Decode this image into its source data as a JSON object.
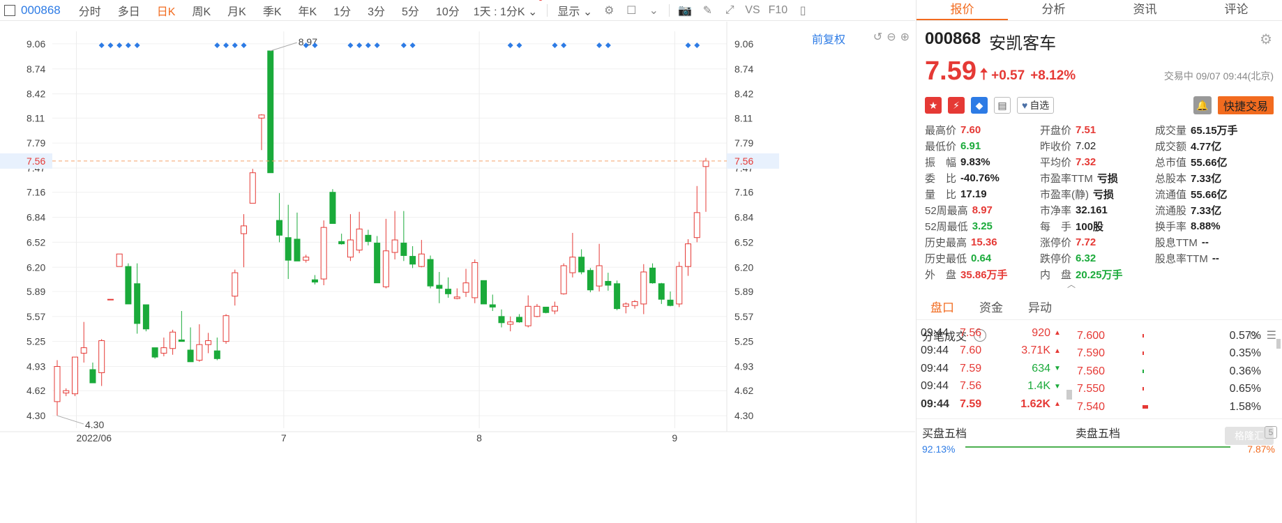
{
  "toolbar": {
    "code": "000868",
    "periods": [
      "分时",
      "多日",
      "日K",
      "周K",
      "月K",
      "季K",
      "年K",
      "1分",
      "3分",
      "5分",
      "10分"
    ],
    "active_period": "日K",
    "range_select": "1天 : 1分K",
    "display_select": "显示",
    "vs_label": "VS",
    "f10_label": "F10"
  },
  "chart": {
    "adjust_label": "前复权",
    "current_price_label": "7.56",
    "high_marker": "8.97",
    "low_marker": "4.30",
    "colors": {
      "up": "#e53935",
      "down": "#1aaa3a",
      "current_line": "#f3a06a",
      "signal": "#2d7be5"
    }
  },
  "chart_data": {
    "type": "candlestick",
    "y_ticks": [
      "9.06",
      "8.74",
      "8.42",
      "8.11",
      "7.79",
      "7.47",
      "7.16",
      "6.84",
      "6.52",
      "6.20",
      "5.89",
      "5.57",
      "5.25",
      "4.93",
      "4.62",
      "4.30"
    ],
    "x_labels": [
      "2022/06",
      "7",
      "8",
      "9"
    ],
    "ylim": [
      4.14,
      9.22
    ],
    "grid": true,
    "current_price": 7.56,
    "candles": [
      {
        "o": 4.48,
        "h": 5.01,
        "l": 4.3,
        "c": 4.93
      },
      {
        "o": 4.59,
        "h": 4.65,
        "l": 4.55,
        "c": 4.62
      },
      {
        "o": 4.58,
        "h": 5.05,
        "l": 4.55,
        "c": 5.05
      },
      {
        "o": 5.1,
        "h": 5.5,
        "l": 4.98,
        "c": 5.17
      },
      {
        "o": 4.89,
        "h": 4.98,
        "l": 4.77,
        "c": 4.72
      },
      {
        "o": 4.85,
        "h": 5.28,
        "l": 4.68,
        "c": 5.26
      },
      {
        "o": 5.79,
        "h": 5.79,
        "l": 5.78,
        "c": 5.79
      },
      {
        "o": 6.21,
        "h": 6.37,
        "l": 6.21,
        "c": 6.37
      },
      {
        "o": 6.21,
        "h": 6.25,
        "l": 5.73,
        "c": 5.73
      },
      {
        "o": 5.99,
        "h": 6.25,
        "l": 5.35,
        "c": 5.48
      },
      {
        "o": 5.72,
        "h": 5.72,
        "l": 5.38,
        "c": 5.41
      },
      {
        "o": 5.17,
        "h": 5.17,
        "l": 5.03,
        "c": 5.05
      },
      {
        "o": 5.1,
        "h": 5.3,
        "l": 5.06,
        "c": 5.17
      },
      {
        "o": 5.16,
        "h": 5.4,
        "l": 5.08,
        "c": 5.37
      },
      {
        "o": 5.27,
        "h": 5.64,
        "l": 5.25,
        "c": 5.25
      },
      {
        "o": 5.14,
        "h": 5.43,
        "l": 4.99,
        "c": 4.99
      },
      {
        "o": 5.01,
        "h": 5.47,
        "l": 4.99,
        "c": 5.21
      },
      {
        "o": 5.21,
        "h": 5.36,
        "l": 5.1,
        "c": 5.26
      },
      {
        "o": 5.13,
        "h": 5.3,
        "l": 5.01,
        "c": 5.03
      },
      {
        "o": 5.25,
        "h": 5.6,
        "l": 5.22,
        "c": 5.58
      },
      {
        "o": 5.83,
        "h": 6.17,
        "l": 5.71,
        "c": 6.13
      },
      {
        "o": 6.63,
        "h": 6.88,
        "l": 6.2,
        "c": 6.73
      },
      {
        "o": 7.02,
        "h": 7.46,
        "l": 7.02,
        "c": 7.41
      },
      {
        "o": 8.11,
        "h": 8.16,
        "l": 7.7,
        "c": 8.15
      },
      {
        "o": 8.97,
        "h": 8.97,
        "l": 7.5,
        "c": 7.41
      },
      {
        "o": 6.8,
        "h": 7.15,
        "l": 6.52,
        "c": 6.61
      },
      {
        "o": 6.58,
        "h": 7.0,
        "l": 6.05,
        "c": 6.29
      },
      {
        "o": 6.56,
        "h": 6.9,
        "l": 6.3,
        "c": 6.28
      },
      {
        "o": 6.29,
        "h": 6.36,
        "l": 6.26,
        "c": 6.33
      },
      {
        "o": 6.04,
        "h": 6.1,
        "l": 5.98,
        "c": 6.01
      },
      {
        "o": 6.05,
        "h": 6.8,
        "l": 5.97,
        "c": 6.71
      },
      {
        "o": 7.16,
        "h": 7.2,
        "l": 6.81,
        "c": 6.76
      },
      {
        "o": 6.53,
        "h": 6.63,
        "l": 6.49,
        "c": 6.5
      },
      {
        "o": 6.33,
        "h": 6.88,
        "l": 6.28,
        "c": 6.55
      },
      {
        "o": 6.42,
        "h": 6.91,
        "l": 6.38,
        "c": 6.69
      },
      {
        "o": 6.61,
        "h": 6.68,
        "l": 6.48,
        "c": 6.53
      },
      {
        "o": 6.51,
        "h": 6.6,
        "l": 6.0,
        "c": 6.0
      },
      {
        "o": 5.95,
        "h": 6.82,
        "l": 5.93,
        "c": 6.41
      },
      {
        "o": 6.39,
        "h": 6.92,
        "l": 6.3,
        "c": 6.55
      },
      {
        "o": 6.51,
        "h": 6.92,
        "l": 6.28,
        "c": 6.35
      },
      {
        "o": 6.34,
        "h": 6.47,
        "l": 6.19,
        "c": 6.24
      },
      {
        "o": 6.21,
        "h": 6.55,
        "l": 6.2,
        "c": 6.37
      },
      {
        "o": 6.3,
        "h": 6.35,
        "l": 5.93,
        "c": 5.96
      },
      {
        "o": 5.97,
        "h": 6.14,
        "l": 5.74,
        "c": 5.93
      },
      {
        "o": 5.92,
        "h": 6.07,
        "l": 5.81,
        "c": 5.86
      },
      {
        "o": 5.8,
        "h": 5.93,
        "l": 5.79,
        "c": 5.82
      },
      {
        "o": 5.88,
        "h": 6.18,
        "l": 5.82,
        "c": 6.0
      },
      {
        "o": 5.81,
        "h": 6.3,
        "l": 5.74,
        "c": 6.26
      },
      {
        "o": 6.03,
        "h": 6.03,
        "l": 5.73,
        "c": 5.73
      },
      {
        "o": 5.72,
        "h": 5.85,
        "l": 5.64,
        "c": 5.69
      },
      {
        "o": 5.57,
        "h": 5.66,
        "l": 5.43,
        "c": 5.49
      },
      {
        "o": 5.47,
        "h": 5.57,
        "l": 5.38,
        "c": 5.5
      },
      {
        "o": 5.56,
        "h": 5.6,
        "l": 5.49,
        "c": 5.5
      },
      {
        "o": 5.45,
        "h": 5.84,
        "l": 5.43,
        "c": 5.7
      },
      {
        "o": 5.57,
        "h": 5.73,
        "l": 5.56,
        "c": 5.7
      },
      {
        "o": 5.69,
        "h": 5.69,
        "l": 5.61,
        "c": 5.62
      },
      {
        "o": 5.64,
        "h": 5.76,
        "l": 5.6,
        "c": 5.7
      },
      {
        "o": 5.86,
        "h": 6.25,
        "l": 5.85,
        "c": 6.22
      },
      {
        "o": 6.13,
        "h": 6.64,
        "l": 6.07,
        "c": 6.33
      },
      {
        "o": 6.33,
        "h": 6.43,
        "l": 6.11,
        "c": 6.14
      },
      {
        "o": 6.16,
        "h": 6.19,
        "l": 5.88,
        "c": 5.91
      },
      {
        "o": 5.96,
        "h": 6.5,
        "l": 5.89,
        "c": 6.22
      },
      {
        "o": 6.02,
        "h": 6.13,
        "l": 5.9,
        "c": 5.97
      },
      {
        "o": 5.99,
        "h": 6.03,
        "l": 5.65,
        "c": 5.67
      },
      {
        "o": 5.7,
        "h": 5.75,
        "l": 5.61,
        "c": 5.73
      },
      {
        "o": 5.71,
        "h": 5.78,
        "l": 5.67,
        "c": 5.76
      },
      {
        "o": 5.73,
        "h": 6.24,
        "l": 5.6,
        "c": 6.14
      },
      {
        "o": 6.19,
        "h": 6.25,
        "l": 5.99,
        "c": 6.0
      },
      {
        "o": 5.99,
        "h": 6.0,
        "l": 5.73,
        "c": 5.79
      },
      {
        "o": 5.78,
        "h": 5.89,
        "l": 5.7,
        "c": 5.71
      },
      {
        "o": 5.73,
        "h": 6.27,
        "l": 5.69,
        "c": 6.21
      },
      {
        "o": 6.21,
        "h": 6.56,
        "l": 6.09,
        "c": 6.5
      },
      {
        "o": 6.58,
        "h": 7.24,
        "l": 6.52,
        "c": 6.9
      },
      {
        "o": 7.49,
        "h": 7.6,
        "l": 6.91,
        "c": 7.56
      }
    ],
    "signal_groups": [
      {
        "from": 5,
        "to": 9
      },
      {
        "from": 18,
        "to": 21
      },
      {
        "from": 28,
        "to": 29
      },
      {
        "from": 33,
        "to": 36
      },
      {
        "from": 39,
        "to": 40
      },
      {
        "from": 51,
        "to": 52
      },
      {
        "from": 56,
        "to": 57
      },
      {
        "from": 61,
        "to": 62
      },
      {
        "from": 71,
        "to": 72
      }
    ]
  },
  "panel": {
    "tabs": [
      "报价",
      "分析",
      "资讯",
      "评论"
    ],
    "active_tab": "报价",
    "code": "000868",
    "name": "安凯客车",
    "price": "7.59",
    "change": "+0.57",
    "change_pct": "+8.12%",
    "status": "交易中 09/07 09:44(北京)",
    "watch_label": "自选",
    "quick_trade": "快捷交易",
    "quote_grid": [
      {
        "label": "最高价",
        "value": "7.60",
        "color": "red"
      },
      {
        "label": "开盘价",
        "value": "7.51",
        "color": "red"
      },
      {
        "label": "成交量",
        "value": "65.15万手",
        "color": ""
      },
      {
        "label": "最低价",
        "value": "6.91",
        "color": "green"
      },
      {
        "label": "昨收价",
        "value": "7.02",
        "color": "plain"
      },
      {
        "label": "成交额",
        "value": "4.77亿",
        "color": ""
      },
      {
        "label": "振　幅",
        "value": "9.83%",
        "color": ""
      },
      {
        "label": "平均价",
        "value": "7.32",
        "color": "red"
      },
      {
        "label": "总市值",
        "value": "55.66亿",
        "color": ""
      },
      {
        "label": "委　比",
        "value": "-40.76%",
        "color": ""
      },
      {
        "label": "市盈率TTM",
        "value": "亏损",
        "color": ""
      },
      {
        "label": "总股本",
        "value": "7.33亿",
        "color": ""
      },
      {
        "label": "量　比",
        "value": "17.19",
        "color": ""
      },
      {
        "label": "市盈率(静)",
        "value": "亏损",
        "color": ""
      },
      {
        "label": "流通值",
        "value": "55.66亿",
        "color": ""
      },
      {
        "label": "52周最高",
        "value": "8.97",
        "color": "red"
      },
      {
        "label": "市净率",
        "value": "32.161",
        "color": ""
      },
      {
        "label": "流通股",
        "value": "7.33亿",
        "color": ""
      },
      {
        "label": "52周最低",
        "value": "3.25",
        "color": "green"
      },
      {
        "label": "每　手",
        "value": "100股",
        "color": ""
      },
      {
        "label": "换手率",
        "value": "8.88%",
        "color": ""
      },
      {
        "label": "历史最高",
        "value": "15.36",
        "color": "red"
      },
      {
        "label": "涨停价",
        "value": "7.72",
        "color": "red"
      },
      {
        "label": "股息TTM",
        "value": "--",
        "color": ""
      },
      {
        "label": "历史最低",
        "value": "0.64",
        "color": "green"
      },
      {
        "label": "跌停价",
        "value": "6.32",
        "color": "green"
      },
      {
        "label": "股息率TTM",
        "value": "--",
        "color": ""
      },
      {
        "label": "外　盘",
        "value": "35.86万手",
        "color": "red"
      },
      {
        "label": "内　盘",
        "value": "20.25万手",
        "color": "green"
      }
    ],
    "subtabs": [
      "盘口",
      "资金",
      "异动"
    ],
    "active_subtab": "盘口",
    "ticks_title": "分笔成交",
    "ticks": [
      {
        "time": "09:44",
        "price": "7.56",
        "vol": "920",
        "dir": "up"
      },
      {
        "time": "09:44",
        "price": "7.60",
        "vol": "3.71K",
        "dir": "up"
      },
      {
        "time": "09:44",
        "price": "7.59",
        "vol": "634",
        "dir": "down"
      },
      {
        "time": "09:44",
        "price": "7.56",
        "vol": "1.4K",
        "dir": "down"
      },
      {
        "time": "09:44",
        "price": "7.59",
        "vol": "1.62K",
        "dir": "up"
      }
    ],
    "levels": [
      {
        "price": "7.600",
        "pct": "0.57%",
        "share": 0.02,
        "color": "#e53935"
      },
      {
        "price": "7.590",
        "pct": "0.35%",
        "share": 0.01,
        "color": "#e53935"
      },
      {
        "price": "7.560",
        "pct": "0.36%",
        "share": 0.01,
        "color": "#1aaa3a"
      },
      {
        "price": "7.550",
        "pct": "0.65%",
        "share": 0.02,
        "color": "#e53935"
      },
      {
        "price": "7.540",
        "pct": "1.58%",
        "share": 0.08,
        "color": "#e53935"
      }
    ],
    "buy_book": "买盘五档",
    "sell_book": "卖盘五档",
    "book_count": "5",
    "book_left_pct": "92.13%",
    "book_right_pct": "7.87%",
    "watermark": "格隆汇"
  }
}
